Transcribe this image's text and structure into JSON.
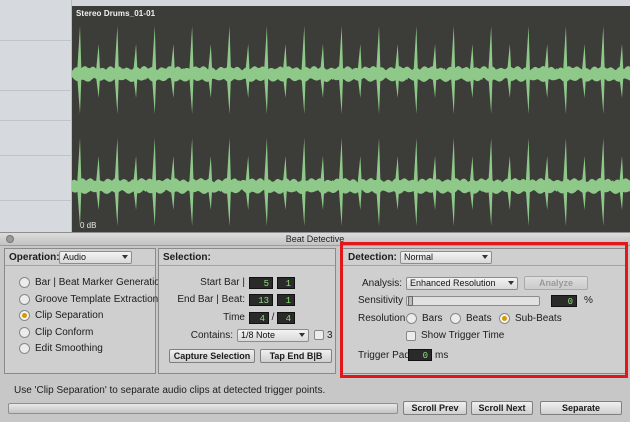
{
  "edit_window": {
    "clip_name": "Stereo Drums_01-01",
    "clip_gain": "0 dB",
    "waveform_color": "#8fc98a",
    "clip_bg_color": "#3c3d39",
    "transients_per_channel": 30
  },
  "beat_detective": {
    "title": "Beat Detective",
    "operation": {
      "label": "Operation:",
      "selected": "Audio",
      "options": [
        {
          "label": "Bar | Beat Marker Generation",
          "selected": false
        },
        {
          "label": "Groove Template Extraction",
          "selected": false
        },
        {
          "label": "Clip Separation",
          "selected": true
        },
        {
          "label": "Clip Conform",
          "selected": false
        },
        {
          "label": "Edit Smoothing",
          "selected": false
        }
      ]
    },
    "selection": {
      "label": "Selection:",
      "start_bar_label": "Start Bar |",
      "start_bar": "5",
      "start_beat": "1",
      "end_bar_label": "End Bar | Beat:",
      "end_bar": "13",
      "end_beat": "1",
      "time_label": "Time",
      "time_num": "4",
      "time_sep": "/",
      "time_den": "4",
      "contains_label": "Contains:",
      "contains_value": "1/8 Note",
      "triplet_label": "3",
      "capture_button": "Capture Selection",
      "tap_end_button": "Tap End B|B"
    },
    "detection": {
      "label": "Detection:",
      "mode": "Normal",
      "analysis_label": "Analysis:",
      "analysis_value": "Enhanced Resolution",
      "analyze_button": "Analyze",
      "sensitivity_label": "Sensitivity",
      "sensitivity_value": "0",
      "sensitivity_unit": "%",
      "resolution_label": "Resolution",
      "resolution_options": [
        {
          "label": "Bars",
          "selected": false
        },
        {
          "label": "Beats",
          "selected": false
        },
        {
          "label": "Sub-Beats",
          "selected": true
        }
      ],
      "show_trigger_time_label": "Show Trigger Time",
      "trigger_pad_label": "Trigger Pad",
      "trigger_pad_value": "0",
      "trigger_pad_unit": "ms"
    },
    "status_message": "Use 'Clip Separation' to separate audio clips at detected trigger points.",
    "scroll_prev_button": "Scroll Prev",
    "scroll_next_button": "Scroll Next",
    "separate_button": "Separate"
  },
  "highlight_color": "#e3161a"
}
